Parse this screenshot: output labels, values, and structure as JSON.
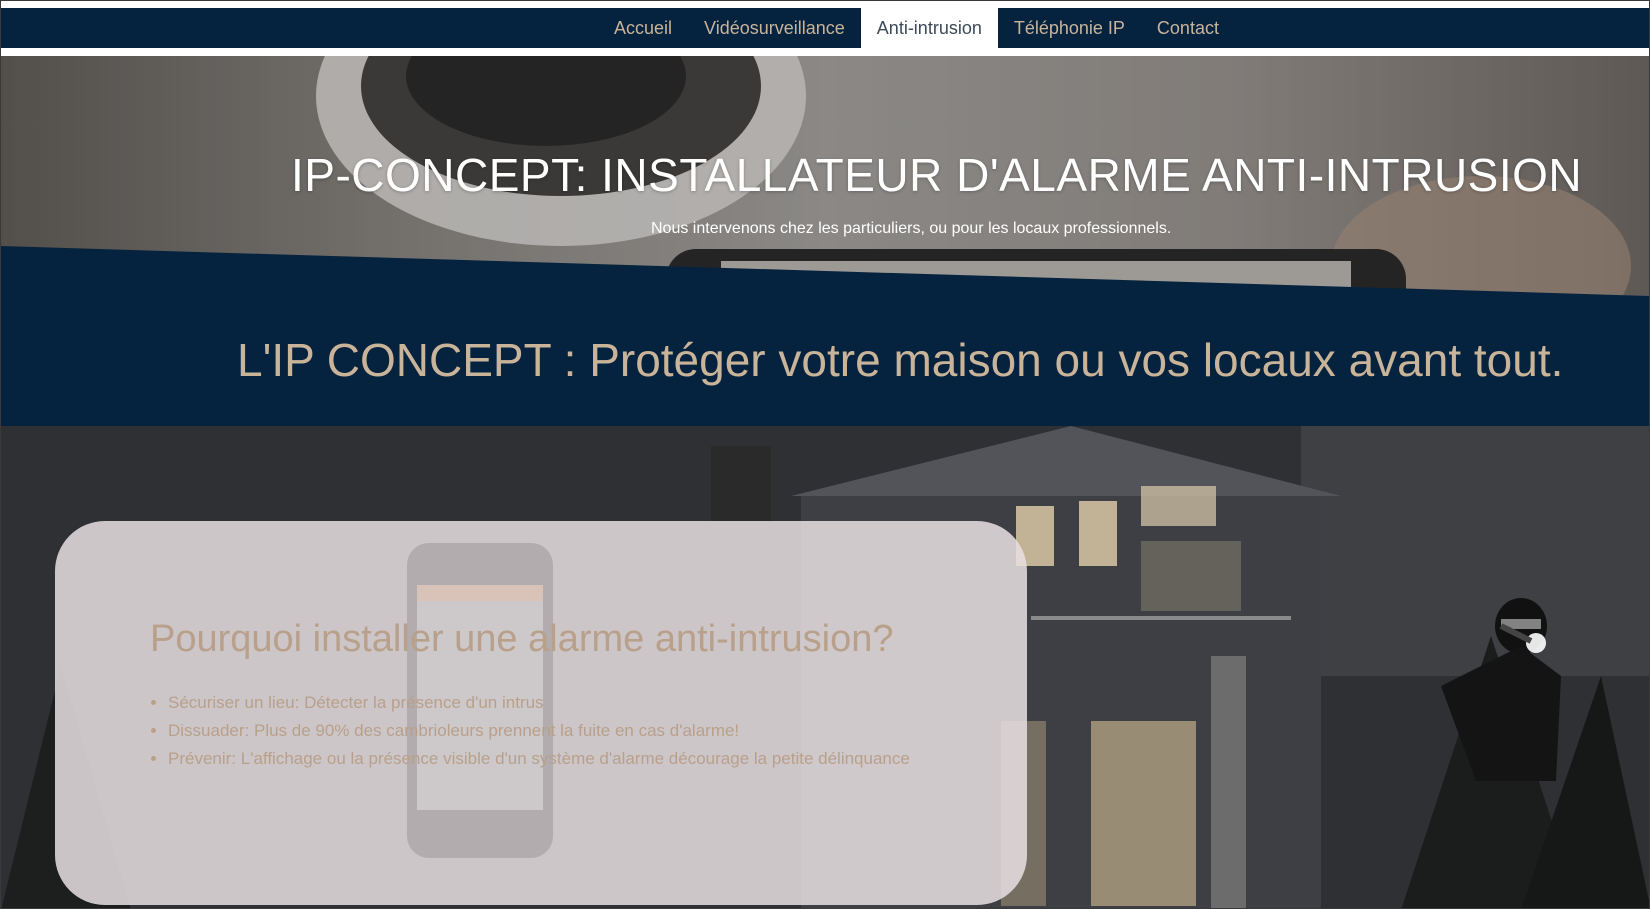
{
  "nav": {
    "items": [
      {
        "label": "Accueil"
      },
      {
        "label": "Vidéosurveillance"
      },
      {
        "label": "Anti-intrusion"
      },
      {
        "label": "Téléphonie IP"
      },
      {
        "label": "Contact"
      }
    ],
    "active": "Anti-intrusion"
  },
  "hero": {
    "title": "IP-CONCEPT: INSTALLATEUR D'ALARME ANTI-INTRUSION",
    "subtitle": "Nous intervenons chez les particuliers, ou pour les locaux professionnels."
  },
  "banner": {
    "text": "L'IP CONCEPT : Protéger votre maison ou vos locaux avant tout."
  },
  "card": {
    "title": "Pourquoi installer une alarme anti-intrusion?",
    "items": [
      "Sécuriser un lieu: Détecter la présence d'un intrus",
      "Dissuader: Plus de 90% des cambrioleurs prennent la fuite en cas d'alarme!",
      "Prévenir: L'affichage ou la présence visible d'un système d'alarme décourage la petite délinquance"
    ]
  },
  "colors": {
    "navy": "#05233f",
    "beige": "#c9b49a",
    "active_text": "#3d4a58"
  }
}
